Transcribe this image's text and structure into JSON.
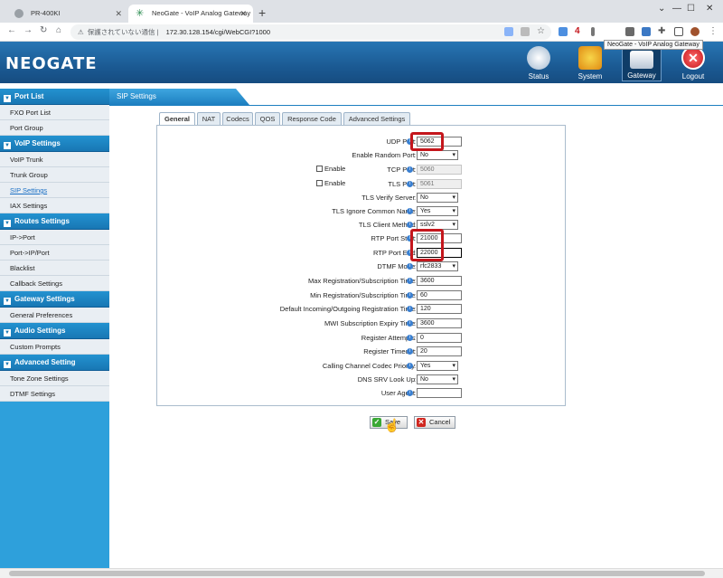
{
  "browser": {
    "tabs": [
      {
        "title": "PR-400KI"
      },
      {
        "title": "NeoGate - VoIP Analog Gateway"
      }
    ],
    "security_label": "保護されていない通信",
    "url": "172.30.128.154/cgi/WebCGI?1000",
    "tooltip": "NeoGate - VoIP Analog Gateway",
    "ext_badge": "4"
  },
  "header": {
    "logo": "NEOGATE",
    "nav": [
      {
        "label": "Status",
        "icon": "status-icon"
      },
      {
        "label": "System",
        "icon": "system-icon"
      },
      {
        "label": "Gateway",
        "icon": "gateway-icon"
      },
      {
        "label": "Logout",
        "icon": "logout-icon"
      }
    ]
  },
  "sidebar": {
    "sections": [
      {
        "title": "Port List",
        "items": [
          "FXO Port List",
          "Port Group"
        ]
      },
      {
        "title": "VoIP Settings",
        "items": [
          "VoIP Trunk",
          "Trunk Group",
          "SIP Settings",
          "IAX Settings"
        ]
      },
      {
        "title": "Routes Settings",
        "items": [
          "IP->Port",
          "Port->IP/Port",
          "Blacklist",
          "Callback Settings"
        ]
      },
      {
        "title": "Gateway Settings",
        "items": [
          "General Preferences"
        ]
      },
      {
        "title": "Audio Settings",
        "items": [
          "Custom Prompts"
        ]
      },
      {
        "title": "Advanced Setting",
        "items": [
          "Tone Zone Settings",
          "DTMF Settings"
        ]
      }
    ],
    "selected": "SIP Settings"
  },
  "main": {
    "title": "SIP Settings",
    "tabs": [
      "General",
      "NAT",
      "Codecs",
      "QOS",
      "Response Code",
      "Advanced Settings"
    ],
    "active_tab": "General",
    "enable_label": "Enable",
    "fields": [
      {
        "label": "UDP Port",
        "value": "5062"
      },
      {
        "label": "Enable Random Port",
        "value": "No"
      },
      {
        "label": "TCP Port",
        "value": "5060"
      },
      {
        "label": "TLS Port",
        "value": "5061"
      },
      {
        "label": "TLS Verify Server",
        "value": "No"
      },
      {
        "label": "TLS Ignore Common Name",
        "value": "Yes"
      },
      {
        "label": "TLS Client Method",
        "value": "sslv2"
      },
      {
        "label": "RTP Port Start",
        "value": "21000"
      },
      {
        "label": "RTP Port End",
        "value": "22000"
      },
      {
        "label": "DTMF Mode",
        "value": "rfc2833"
      },
      {
        "label": "Max Registration/Subscription Time",
        "value": "3600"
      },
      {
        "label": "Min Registration/Subscription Time",
        "value": "60"
      },
      {
        "label": "Default Incoming/Outgoing Registration Time",
        "value": "120"
      },
      {
        "label": "MWI Subscription Expiry Time",
        "value": "3600"
      },
      {
        "label": "Register Attempts",
        "value": "0"
      },
      {
        "label": "Register Timeout",
        "value": "20"
      },
      {
        "label": "Calling Channel Codec Priority",
        "value": "Yes"
      },
      {
        "label": "DNS SRV Look Up",
        "value": "No"
      },
      {
        "label": "User Agent",
        "value": ""
      }
    ],
    "info_glyph": "i",
    "colon": ":",
    "save_label": "Save",
    "cancel_label": "Cancel"
  }
}
